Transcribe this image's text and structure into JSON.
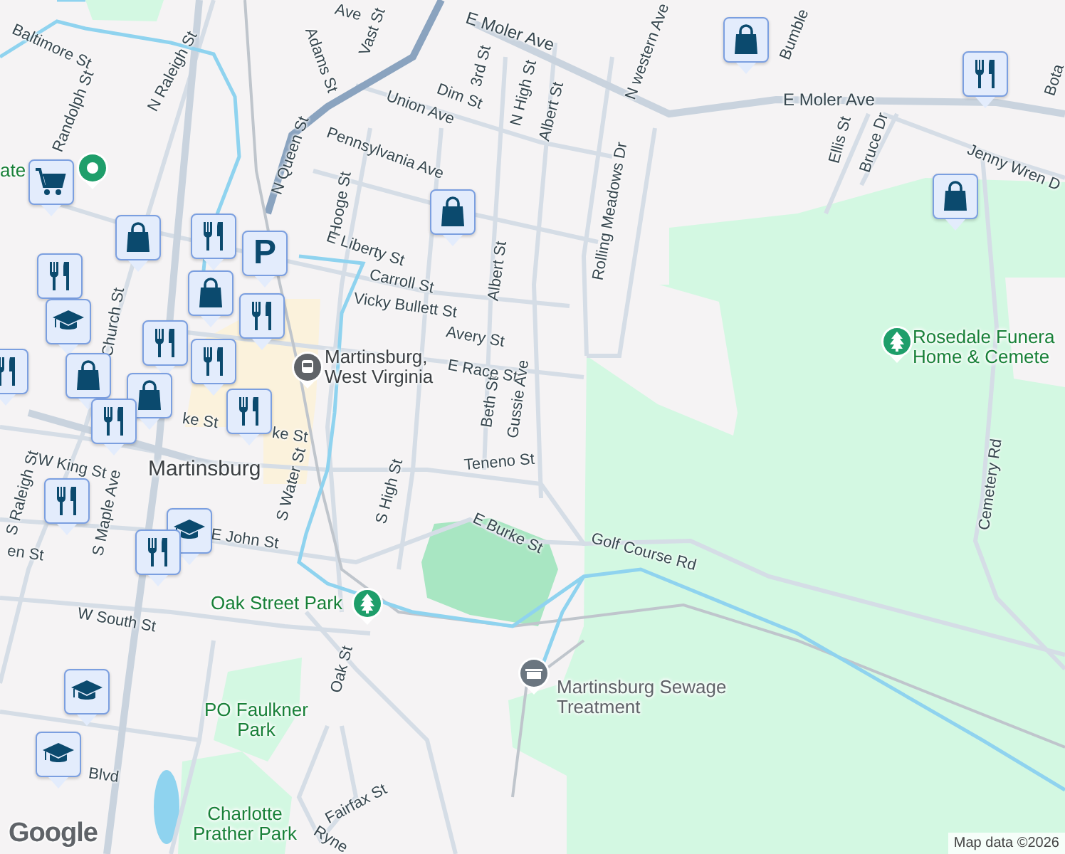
{
  "map": {
    "street_labels": [
      {
        "text": "Baltimore St"
      },
      {
        "text": "N Raleigh St"
      },
      {
        "text": "Randolph St"
      },
      {
        "text": "Adams St"
      },
      {
        "text": "Vast St"
      },
      {
        "text": "Ave"
      },
      {
        "text": "E Moler Ave"
      },
      {
        "text": "Dim St"
      },
      {
        "text": "3rd St"
      },
      {
        "text": "N High St"
      },
      {
        "text": "Union Ave"
      },
      {
        "text": "N Queen St"
      },
      {
        "text": "Pennsylvania Ave"
      },
      {
        "text": "Albert St"
      },
      {
        "text": "Hooge St"
      },
      {
        "text": "E Liberty St"
      },
      {
        "text": "Carroll St"
      },
      {
        "text": "Albert St"
      },
      {
        "text": "Vicky Bullett St"
      },
      {
        "text": "Avery St"
      },
      {
        "text": "E Race St"
      },
      {
        "text": "Beth St"
      },
      {
        "text": "Gussie Ave"
      },
      {
        "text": "Teneno St"
      },
      {
        "text": "E Burke St"
      },
      {
        "text": "Golf Course Rd"
      },
      {
        "text": "S High St"
      },
      {
        "text": "S Water St"
      },
      {
        "text": "Church St"
      },
      {
        "text": "W King St"
      },
      {
        "text": "ke St"
      },
      {
        "text": "ke St"
      },
      {
        "text": "S Raleigh St"
      },
      {
        "text": "S Maple Ave"
      },
      {
        "text": "E John St"
      },
      {
        "text": "en St"
      },
      {
        "text": "W South St"
      },
      {
        "text": "Oak St"
      },
      {
        "text": "Fairfax St"
      },
      {
        "text": "Ryne"
      },
      {
        "text": "Blvd"
      },
      {
        "text": "N western Ave"
      },
      {
        "text": "Bumble"
      },
      {
        "text": "E Moler Ave"
      },
      {
        "text": "Ellis St"
      },
      {
        "text": "Bruce Dr"
      },
      {
        "text": "Jenny Wren D"
      },
      {
        "text": "Bota"
      },
      {
        "text": "Rolling Meadows Dr"
      },
      {
        "text": "Cemetery Rd"
      }
    ],
    "place_labels": [
      {
        "text": "ate",
        "kind": "park"
      },
      {
        "text": "Martinsburg, West Virginia",
        "kind": "transit"
      },
      {
        "text": "Martinsburg",
        "kind": "city"
      },
      {
        "text": "Oak Street Park",
        "kind": "park"
      },
      {
        "text": "PO Faulkner Park",
        "kind": "park"
      },
      {
        "text": "Charlotte Prather Park",
        "kind": "park"
      },
      {
        "text": "Martinsburg Sewage Treatment",
        "kind": "facility"
      },
      {
        "text": "Rosedale Funera Home & Cemete",
        "kind": "park"
      }
    ],
    "markers": [
      {
        "kind": "restaurant"
      },
      {
        "kind": "shopping"
      },
      {
        "kind": "shopping"
      },
      {
        "kind": "shopping"
      },
      {
        "kind": "cart"
      },
      {
        "kind": "shopping"
      },
      {
        "kind": "restaurant"
      },
      {
        "kind": "restaurant"
      },
      {
        "kind": "parking",
        "glyph": "P"
      },
      {
        "kind": "shopping"
      },
      {
        "kind": "school"
      },
      {
        "kind": "restaurant"
      },
      {
        "kind": "restaurant"
      },
      {
        "kind": "restaurant"
      },
      {
        "kind": "restaurant"
      },
      {
        "kind": "shopping"
      },
      {
        "kind": "shopping"
      },
      {
        "kind": "restaurant"
      },
      {
        "kind": "restaurant"
      },
      {
        "kind": "restaurant"
      },
      {
        "kind": "school"
      },
      {
        "kind": "restaurant"
      },
      {
        "kind": "school"
      },
      {
        "kind": "school"
      }
    ],
    "pins": [
      {
        "kind": "location"
      },
      {
        "kind": "park"
      },
      {
        "kind": "park"
      },
      {
        "kind": "transit"
      },
      {
        "kind": "facility"
      }
    ],
    "attribution": {
      "logo": "Google",
      "text": "Map data ©2026"
    }
  }
}
